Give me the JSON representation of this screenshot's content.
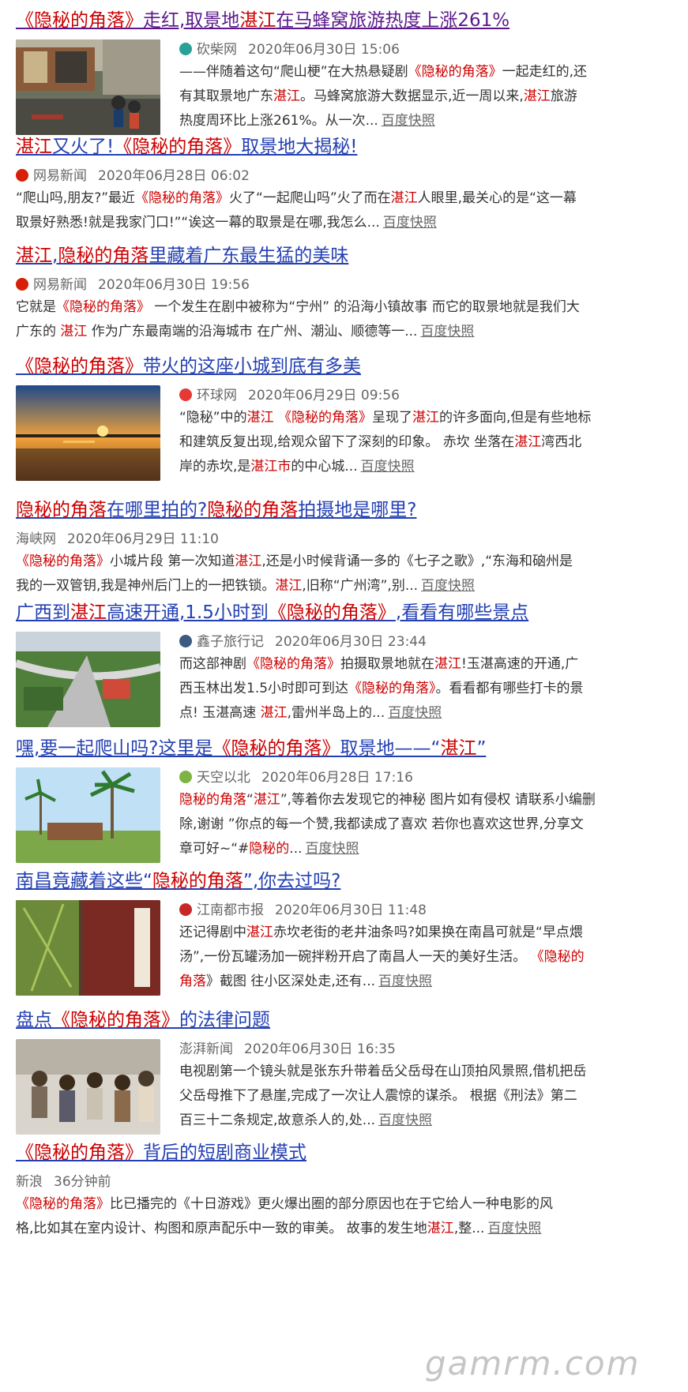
{
  "results": [
    {
      "title": [
        {
          "t": "《隐秘的角落》",
          "h": true
        },
        {
          "t": "走红,取景地",
          "h": false
        },
        {
          "t": "湛江",
          "h": true
        },
        {
          "t": "在马蜂窝旅游热度上涨261%",
          "h": false
        }
      ],
      "visited": true,
      "source": "砍柴网",
      "icon_color": "#2aa198",
      "date": "2020年06月30日 15:06",
      "thumb": "street",
      "lines": [
        [
          {
            "t": "——伴随着这句“爬山梗”在大热悬疑剧",
            "h": false
          },
          {
            "t": "《隐秘的角落》",
            "h": true
          },
          {
            "t": "一起走红的,还",
            "h": false
          }
        ],
        [
          {
            "t": "有其取景地广东",
            "h": false
          },
          {
            "t": "湛江",
            "h": true
          },
          {
            "t": "。马蜂窝旅游大数据显示,近一周以来,",
            "h": false
          },
          {
            "t": "湛江",
            "h": true
          },
          {
            "t": "旅游",
            "h": false
          }
        ],
        [
          {
            "t": "热度周环比上涨261%。从一次...",
            "h": false
          }
        ]
      ],
      "snapshot": "百度快照"
    },
    {
      "title": [
        {
          "t": "湛江",
          "h": true
        },
        {
          "t": "又火了!",
          "h": false
        },
        {
          "t": "《隐秘的角落》",
          "h": true
        },
        {
          "t": "取景地大揭秘!",
          "h": false
        }
      ],
      "visited": false,
      "source": "网易新闻",
      "icon_color": "#d81e06",
      "date": "2020年06月28日 06:02",
      "thumb": "",
      "lines": [
        [
          {
            "t": "“爬山吗,朋友?”最近",
            "h": false
          },
          {
            "t": "《隐秘的角落》",
            "h": true
          },
          {
            "t": "火了“一起爬山吗”火了而在",
            "h": false
          },
          {
            "t": "湛江",
            "h": true
          },
          {
            "t": "人眼里,最关心的是“这一幕",
            "h": false
          }
        ],
        [
          {
            "t": "取景好熟悉!就是我家门口!”“诶这一幕的取景是在哪,我怎么...",
            "h": false
          }
        ]
      ],
      "snapshot": "百度快照"
    },
    {
      "title": [
        {
          "t": "湛江",
          "h": true
        },
        {
          "t": ",",
          "h": false
        },
        {
          "t": "隐秘的角落",
          "h": true
        },
        {
          "t": "里藏着广东最生猛的美味",
          "h": false
        }
      ],
      "visited": false,
      "source": "网易新闻",
      "icon_color": "#d81e06",
      "date": "2020年06月30日 19:56",
      "thumb": "",
      "lines": [
        [
          {
            "t": "它就是",
            "h": false
          },
          {
            "t": "《隐秘的角落》",
            "h": true
          },
          {
            "t": " 一个发生在剧中被称为“宁州” 的沿海小镇故事 而它的取景地就是我们大",
            "h": false
          }
        ],
        [
          {
            "t": "广东的 ",
            "h": false
          },
          {
            "t": "湛江",
            "h": true
          },
          {
            "t": " 作为广东最南端的沿海城市 在广州、潮汕、顺德等一...",
            "h": false
          }
        ]
      ],
      "snapshot": "百度快照"
    },
    {
      "title": [
        {
          "t": "《隐秘的角落》",
          "h": true
        },
        {
          "t": "带火的这座小城到底有多美",
          "h": false
        }
      ],
      "visited": false,
      "source": "环球网",
      "icon_color": "#e53935",
      "date": "2020年06月29日 09:56",
      "thumb": "sunset",
      "lines": [
        [
          {
            "t": "“隐秘”中的",
            "h": false
          },
          {
            "t": "湛江",
            "h": true
          },
          {
            "t": " ",
            "h": false
          },
          {
            "t": "《隐秘的角落》",
            "h": true
          },
          {
            "t": "呈现了",
            "h": false
          },
          {
            "t": "湛江",
            "h": true
          },
          {
            "t": "的许多面向,但是有些地标",
            "h": false
          }
        ],
        [
          {
            "t": "和建筑反复出现,给观众留下了深刻的印象。 赤坎 坐落在",
            "h": false
          },
          {
            "t": "湛江",
            "h": true
          },
          {
            "t": "湾西北",
            "h": false
          }
        ],
        [
          {
            "t": "岸的赤坎,是",
            "h": false
          },
          {
            "t": "湛江市",
            "h": true
          },
          {
            "t": "的中心城...",
            "h": false
          }
        ]
      ],
      "snapshot": "百度快照"
    },
    {
      "title": [
        {
          "t": "隐秘的角落",
          "h": true
        },
        {
          "t": "在哪里拍的?",
          "h": false
        },
        {
          "t": "隐秘的角落",
          "h": true
        },
        {
          "t": "拍摄地是哪里?",
          "h": false
        }
      ],
      "visited": false,
      "source": "海峡网",
      "icon_color": "",
      "date": "2020年06月29日 11:10",
      "thumb": "",
      "lines": [
        [
          {
            "t": "《隐秘的角落》",
            "h": true
          },
          {
            "t": "小城片段 第一次知道",
            "h": false
          },
          {
            "t": "湛江",
            "h": true
          },
          {
            "t": ",还是小时候背诵一多的《七子之歌》,“东海和硇州是",
            "h": false
          }
        ],
        [
          {
            "t": "我的一双管钥,我是神州后门上的一把铁锁。",
            "h": false
          },
          {
            "t": "湛江",
            "h": true
          },
          {
            "t": ",旧称“广州湾”,别...",
            "h": false
          }
        ]
      ],
      "snapshot": "百度快照"
    },
    {
      "title": [
        {
          "t": "广西到",
          "h": false
        },
        {
          "t": "湛江",
          "h": true
        },
        {
          "t": "高速开通,1.5小时到",
          "h": false
        },
        {
          "t": "《隐秘的角落》",
          "h": true
        },
        {
          "t": ",看看有哪些景点",
          "h": false
        }
      ],
      "visited": false,
      "source": "鑫子旅行记",
      "icon_color": "#3d5a80",
      "date": "2020年06月30日 23:44",
      "thumb": "highway",
      "lines": [
        [
          {
            "t": "而这部神剧",
            "h": false
          },
          {
            "t": "《隐秘的角落》",
            "h": true
          },
          {
            "t": "拍摄取景地就在",
            "h": false
          },
          {
            "t": "湛江",
            "h": true
          },
          {
            "t": "!玉湛高速的开通,广",
            "h": false
          }
        ],
        [
          {
            "t": "西玉林出发1.5小时即可到达",
            "h": false
          },
          {
            "t": "《隐秘的角落》",
            "h": true
          },
          {
            "t": "。看看都有哪些打卡的景",
            "h": false
          }
        ],
        [
          {
            "t": "点! 玉湛高速 ",
            "h": false
          },
          {
            "t": "湛江",
            "h": true
          },
          {
            "t": ",雷州半岛上的...",
            "h": false
          }
        ]
      ],
      "snapshot": "百度快照"
    },
    {
      "title": [
        {
          "t": "嘿,要一起爬山吗?这里是",
          "h": false
        },
        {
          "t": "《隐秘的角落》",
          "h": true
        },
        {
          "t": "取景地——“",
          "h": false
        },
        {
          "t": "湛江",
          "h": true
        },
        {
          "t": "”",
          "h": false
        }
      ],
      "visited": false,
      "source": "天空以北",
      "icon_color": "#7cb342",
      "date": "2020年06月28日 17:16",
      "thumb": "palms",
      "lines": [
        [
          {
            "t": "隐秘的角落",
            "h": true
          },
          {
            "t": "“",
            "h": false
          },
          {
            "t": "湛江",
            "h": true
          },
          {
            "t": "”,等着你去发现它的神秘 图片如有侵权 请联系小编删",
            "h": false
          }
        ],
        [
          {
            "t": "除,谢谢 ”你点的每一个赞,我都读成了喜欢 若你也喜欢这世界,分享文",
            "h": false
          }
        ],
        [
          {
            "t": "章可好~“#",
            "h": false
          },
          {
            "t": "隐秘的",
            "h": true
          },
          {
            "t": "...",
            "h": false
          }
        ]
      ],
      "snapshot": "百度快照"
    },
    {
      "title": [
        {
          "t": "南昌竟藏着这些“",
          "h": false
        },
        {
          "t": "隐秘的角落",
          "h": true
        },
        {
          "t": "”,你去过吗?",
          "h": false
        }
      ],
      "visited": false,
      "source": "江南都市报",
      "icon_color": "#c62828",
      "date": "2020年06月30日 11:48",
      "thumb": "poster",
      "lines": [
        [
          {
            "t": "还记得剧中",
            "h": false
          },
          {
            "t": "湛江",
            "h": true
          },
          {
            "t": "赤坎老街的老井油条吗?如果换在南昌可就是“早点煨",
            "h": false
          }
        ],
        [
          {
            "t": "汤”,一份瓦罐汤加一碗拌粉开启了南昌人一天的美好生活。 ",
            "h": false
          },
          {
            "t": "《隐秘的",
            "h": true
          }
        ],
        [
          {
            "t": "角落",
            "h": true
          },
          {
            "t": "》截图 往小区深处走,还有...",
            "h": false
          }
        ]
      ],
      "snapshot": "百度快照"
    },
    {
      "title": [
        {
          "t": "盘点",
          "h": false
        },
        {
          "t": "《隐秘的角落》",
          "h": true
        },
        {
          "t": "的法律问题",
          "h": false
        }
      ],
      "visited": false,
      "source": "澎湃新闻",
      "icon_color": "",
      "date": "2020年06月30日 16:35",
      "thumb": "cast",
      "lines": [
        [
          {
            "t": "电视剧第一个镜头就是张东升带着岳父岳母在山顶拍风景照,借机把岳",
            "h": false
          }
        ],
        [
          {
            "t": "父岳母推下了悬崖,完成了一次让人震惊的谋杀。 根据《刑法》第二",
            "h": false
          }
        ],
        [
          {
            "t": "百三十二条规定,故意杀人的,处...",
            "h": false
          }
        ]
      ],
      "snapshot": "百度快照"
    },
    {
      "title": [
        {
          "t": "《隐秘的角落》",
          "h": true
        },
        {
          "t": "背后的短剧商业模式",
          "h": false
        }
      ],
      "visited": false,
      "source": "新浪",
      "icon_color": "",
      "date": "36分钟前",
      "thumb": "",
      "lines": [
        [
          {
            "t": "《隐秘的角落》",
            "h": true
          },
          {
            "t": "比已播完的《十日游戏》更火爆出圈的部分原因也在于它给人一种电影的风",
            "h": false
          }
        ],
        [
          {
            "t": "格,比如其在室内设计、构图和原声配乐中一致的审美。 故事的发生地",
            "h": false
          },
          {
            "t": "湛江",
            "h": true
          },
          {
            "t": ",整...",
            "h": false
          }
        ]
      ],
      "snapshot": "百度快照"
    }
  ],
  "watermark": "gamrm.com",
  "colors": {
    "title_link": "#2440b3",
    "title_visited": "#5b1a8c",
    "highlight": "#cc0000",
    "meta": "#666666",
    "body_text": "#333333"
  }
}
